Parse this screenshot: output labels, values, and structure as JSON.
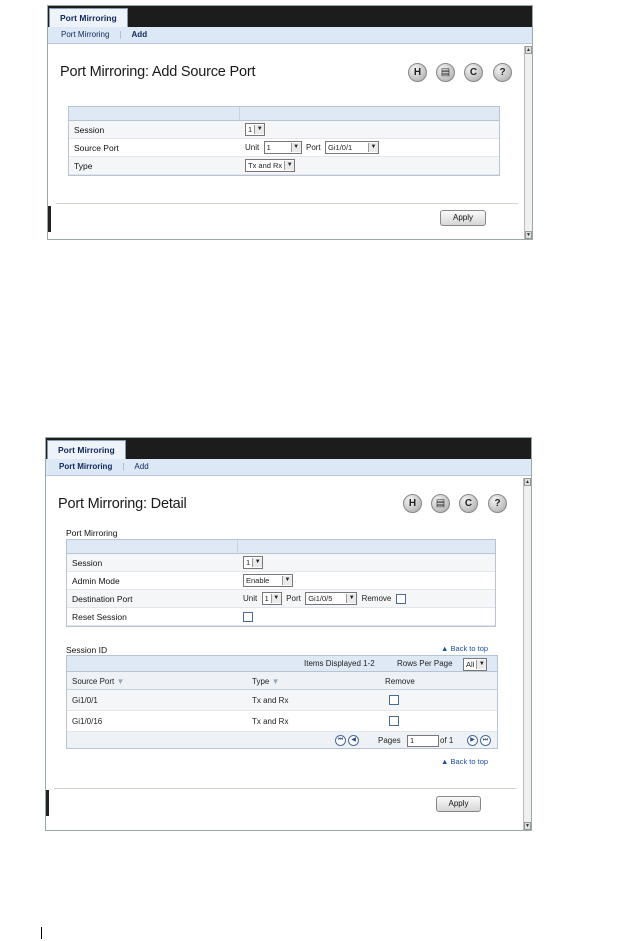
{
  "screen1": {
    "tab": "Port Mirroring",
    "nav": [
      "Port Mirroring",
      "Add"
    ],
    "title": "Port Mirroring: Add Source Port",
    "rows": {
      "session": {
        "label": "Session",
        "value": "1"
      },
      "source_port": {
        "label": "Source Port",
        "unit_label": "Unit",
        "unit_value": "1",
        "port_label": "Port",
        "port_value": "Gi1/0/1"
      },
      "type": {
        "label": "Type",
        "value": "Tx and Rx"
      }
    },
    "apply": "Apply"
  },
  "screen2": {
    "tab": "Port Mirroring",
    "nav": [
      "Port Mirroring",
      "Add"
    ],
    "title": "Port Mirroring: Detail",
    "section": "Port Mirroring",
    "rows": {
      "session": {
        "label": "Session",
        "value": "1"
      },
      "admin_mode": {
        "label": "Admin Mode",
        "value": "Enable"
      },
      "destination_port": {
        "label": "Destination Port",
        "unit_label": "Unit",
        "unit_value": "1",
        "port_label": "Port",
        "port_value": "Gi1/0/5",
        "remove_label": "Remove"
      },
      "reset_session": {
        "label": "Reset Session"
      }
    },
    "session_table": {
      "label": "Session ID",
      "back_to_top": "Back to top",
      "items_displayed": "Items Displayed 1-2",
      "rows_per_page_label": "Rows Per Page",
      "rows_per_page_value": "All",
      "columns": [
        "Source Port",
        "Type",
        "Remove"
      ],
      "rows": [
        {
          "source_port": "Gi1/0/1",
          "type": "Tx and Rx"
        },
        {
          "source_port": "Gi1/0/16",
          "type": "Tx and Rx"
        }
      ],
      "pages_label": "Pages",
      "page_value": "1",
      "of_label": "of 1"
    },
    "apply": "Apply"
  },
  "icons": [
    "save-icon",
    "print-icon",
    "refresh-icon",
    "help-icon"
  ]
}
